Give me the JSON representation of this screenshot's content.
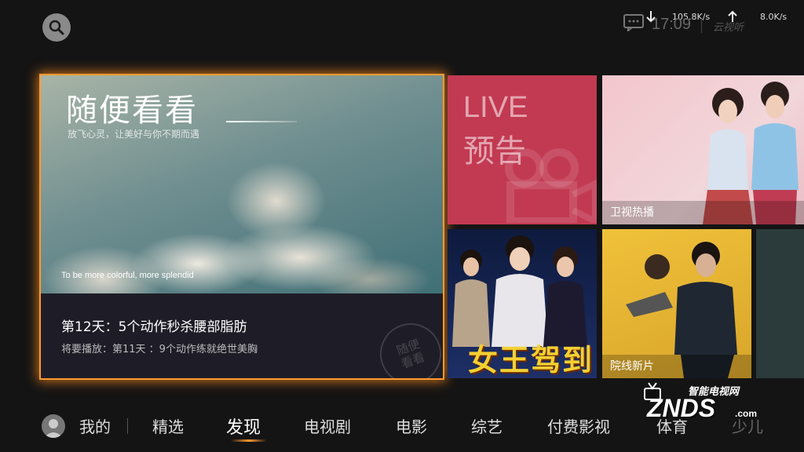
{
  "status_bar": {
    "download_speed": "105.8K/s",
    "upload_speed": "8.0K/s",
    "time": "17:09",
    "brand": "云视听"
  },
  "featured": {
    "title": "随便看看",
    "subtitle": "放飞心灵，让美好与你不期而遇",
    "english_tagline": "To be more colorful, more splendid",
    "program_title": "第12天：5个动作秒杀腰部脂肪",
    "next_program": "将要播放：第11天 ：9个动作练就绝世美胸",
    "stamp_text": "随便看看"
  },
  "tiles": {
    "live_en": "LIVE",
    "live_cn": "预告",
    "weishi_label": "卫视热播",
    "nvwang_title": "女王驾到",
    "yuanxian_label": "院线新片"
  },
  "nav": {
    "me": "我的",
    "items": [
      "精选",
      "发现",
      "电视剧",
      "电影",
      "综艺",
      "付费影视",
      "体育",
      "少儿"
    ],
    "active": "发现"
  },
  "watermark": {
    "top": "智能电视网",
    "main": "ZNDS",
    "suffix": ".com"
  },
  "colors": {
    "focus_glow": "#ff9a2e",
    "live_tile": "#c23a52",
    "yuanxian_tile": "#f0c13a",
    "background": "#141414"
  }
}
